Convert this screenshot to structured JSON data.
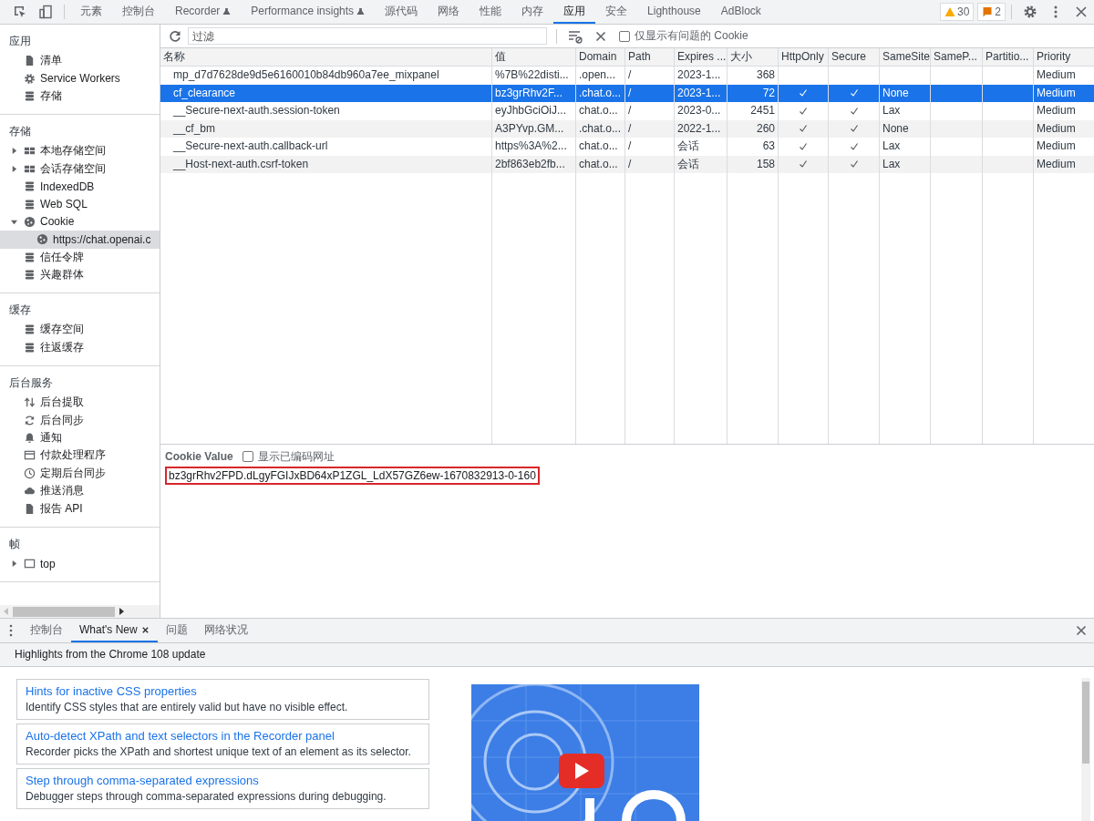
{
  "toolbar": {
    "tabs": [
      {
        "label": "元素",
        "selected": false,
        "experimental": false
      },
      {
        "label": "控制台",
        "selected": false,
        "experimental": false
      },
      {
        "label": "Recorder",
        "selected": false,
        "experimental": true
      },
      {
        "label": "Performance insights",
        "selected": false,
        "experimental": true
      },
      {
        "label": "源代码",
        "selected": false,
        "experimental": false
      },
      {
        "label": "网络",
        "selected": false,
        "experimental": false
      },
      {
        "label": "性能",
        "selected": false,
        "experimental": false
      },
      {
        "label": "内存",
        "selected": false,
        "experimental": false
      },
      {
        "label": "应用",
        "selected": true,
        "experimental": false
      },
      {
        "label": "安全",
        "selected": false,
        "experimental": false
      },
      {
        "label": "Lighthouse",
        "selected": false,
        "experimental": false
      },
      {
        "label": "AdBlock",
        "selected": false,
        "experimental": false
      }
    ],
    "warnings": "30",
    "issues": "2"
  },
  "sidebar": {
    "sections": [
      {
        "title": "应用",
        "items": [
          {
            "label": "清单",
            "kind": "file",
            "selected": false
          },
          {
            "label": "Service Workers",
            "kind": "gear",
            "selected": false
          },
          {
            "label": "存储",
            "kind": "database",
            "selected": false
          }
        ]
      },
      {
        "title": "存储",
        "items": [
          {
            "label": "本地存储空间",
            "kind": "grid",
            "selected": false,
            "expanded": false
          },
          {
            "label": "会话存储空间",
            "kind": "grid",
            "selected": false,
            "expanded": false
          },
          {
            "label": "IndexedDB",
            "kind": "database",
            "selected": false
          },
          {
            "label": "Web SQL",
            "kind": "database",
            "selected": false
          },
          {
            "label": "Cookie",
            "kind": "cookie",
            "selected": false,
            "expanded": true,
            "children": [
              {
                "label": "https://chat.openai.c",
                "kind": "cookie",
                "selected": true
              }
            ]
          },
          {
            "label": "信任令牌",
            "kind": "database",
            "selected": false
          },
          {
            "label": "兴趣群体",
            "kind": "database",
            "selected": false
          }
        ]
      },
      {
        "title": "缓存",
        "items": [
          {
            "label": "缓存空间",
            "kind": "database",
            "selected": false
          },
          {
            "label": "往返缓存",
            "kind": "database",
            "selected": false
          }
        ]
      },
      {
        "title": "后台服务",
        "items": [
          {
            "label": "后台提取",
            "kind": "arrows",
            "selected": false
          },
          {
            "label": "后台同步",
            "kind": "sync",
            "selected": false
          },
          {
            "label": "通知",
            "kind": "bell",
            "selected": false
          },
          {
            "label": "付款处理程序",
            "kind": "card",
            "selected": false
          },
          {
            "label": "定期后台同步",
            "kind": "clock",
            "selected": false
          },
          {
            "label": "推送消息",
            "kind": "cloud",
            "selected": false
          },
          {
            "label": "报告 API",
            "kind": "file",
            "selected": false
          }
        ]
      },
      {
        "title": "帧",
        "items": [
          {
            "label": "top",
            "kind": "frame",
            "selected": false,
            "expanded": false
          }
        ]
      }
    ]
  },
  "cookie_toolbar": {
    "filter": {
      "placeholder": "过滤"
    },
    "only_issues": {
      "label": "仅显示有问题的 Cookie",
      "checked": false
    }
  },
  "table": {
    "columns": [
      "名称",
      "值",
      "Domain",
      "Path",
      "Expires ...",
      "大小",
      "HttpOnly",
      "Secure",
      "SameSite",
      "SameP...",
      "Partitio...",
      "Priority"
    ],
    "rows": [
      {
        "name": "mp_d7d7628de9d5e6160010b84db960a7ee_mixpanel",
        "value": "%7B%22disti...",
        "domain": ".open...",
        "path": "/",
        "expires": "2023-1...",
        "size": "368",
        "http_only": false,
        "secure": false,
        "priority": "Medium",
        "selected": false
      },
      {
        "name": "cf_clearance",
        "value": "bz3grRhv2F...",
        "domain": ".chat.o...",
        "path": "/",
        "expires": "2023-1...",
        "size": "72",
        "http_only": true,
        "secure": true,
        "same_site": "None",
        "priority": "Medium",
        "selected": true
      },
      {
        "name": "__Secure-next-auth.session-token",
        "value": "eyJhbGciOiJ...",
        "domain": "chat.o...",
        "path": "/",
        "expires": "2023-0...",
        "size": "2451",
        "http_only": true,
        "secure": true,
        "same_site": "Lax",
        "priority": "Medium",
        "selected": false
      },
      {
        "name": "__cf_bm",
        "value": "A3PYvp.GM...",
        "domain": ".chat.o...",
        "path": "/",
        "expires": "2022-1...",
        "size": "260",
        "http_only": true,
        "secure": true,
        "same_site": "None",
        "priority": "Medium",
        "selected": false
      },
      {
        "name": "__Secure-next-auth.callback-url",
        "value": "https%3A%2...",
        "domain": "chat.o...",
        "path": "/",
        "expires": "会话",
        "size": "63",
        "http_only": true,
        "secure": true,
        "same_site": "Lax",
        "priority": "Medium",
        "selected": false
      },
      {
        "name": "__Host-next-auth.csrf-token",
        "value": "2bf863eb2fb...",
        "domain": "chat.o...",
        "path": "/",
        "expires": "会话",
        "size": "158",
        "http_only": true,
        "secure": true,
        "same_site": "Lax",
        "priority": "Medium",
        "selected": false
      }
    ]
  },
  "cookie_value": {
    "title": "Cookie Value",
    "show_decoded": {
      "label": "显示已编码网址",
      "checked": false
    },
    "value": "bz3grRhv2FPD.dLgyFGIJxBD64xP1ZGL_LdX57GZ6ew-1670832913-0-160"
  },
  "drawer": {
    "tabs": [
      {
        "label": "控制台",
        "selected": false,
        "closable": false
      },
      {
        "label": "What's New",
        "selected": true,
        "closable": true
      },
      {
        "label": "问题",
        "selected": false,
        "closable": false
      },
      {
        "label": "网络状况",
        "selected": false,
        "closable": false
      }
    ],
    "heading": "Highlights from the Chrome 108 update",
    "cards": [
      {
        "title": "Hints for inactive CSS properties",
        "description": "Identify CSS styles that are entirely valid but have no visible effect."
      },
      {
        "title": "Auto-detect XPath and text selectors in the Recorder panel",
        "description": "Recorder picks the XPath and shortest unique text of an element as its selector."
      },
      {
        "title": "Step through comma-separated expressions",
        "description": "Debugger steps through comma-separated expressions during debugging."
      }
    ]
  }
}
